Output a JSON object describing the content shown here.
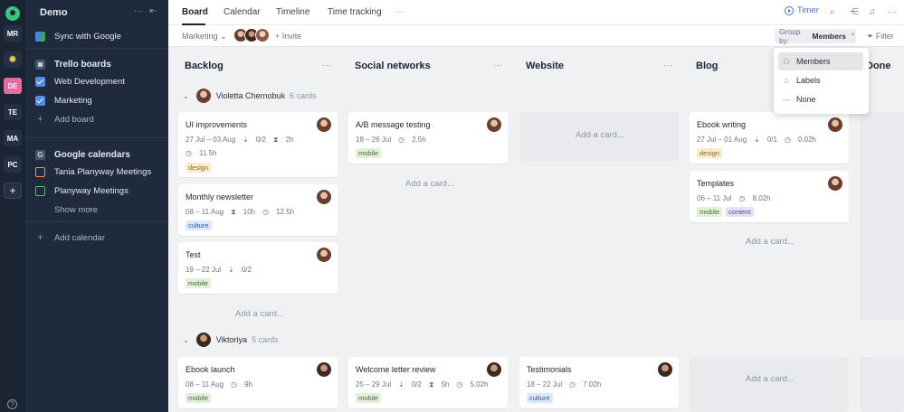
{
  "workspaces": [
    "MR",
    "DE",
    "TE",
    "MA",
    "PC"
  ],
  "sidebar": {
    "title": "Demo",
    "sync_label": "Sync with Google",
    "trello_header": "Trello boards",
    "boards": [
      "Web Development",
      "Marketing"
    ],
    "add_board": "Add board",
    "calendars_header": "Google calendars",
    "calendars": [
      "Tania Planyway Meetings",
      "Planyway Meetings"
    ],
    "show_more": "Show more",
    "add_calendar": "Add calendar"
  },
  "tabs": [
    "Board",
    "Calendar",
    "Timeline",
    "Time tracking"
  ],
  "toolbar": {
    "timer": "Timer",
    "board_filter": "Marketing",
    "invite": "Invite",
    "group_by_label": "Group by:",
    "group_by_value": "Members",
    "filter": "Filter"
  },
  "columns": [
    "Backlog",
    "Social networks",
    "Website",
    "Blog",
    "Done"
  ],
  "groups": [
    {
      "name": "Violetta Chernobuk",
      "count": "6 cards"
    },
    {
      "name": "Viktoriya",
      "count": "5 cards"
    }
  ],
  "cards": {
    "ui": {
      "title": "UI improvements",
      "dates": "27 Jul – 03 Aug",
      "checklist": "0/2",
      "estimate": "2h",
      "time": "11.5h",
      "tag": "design"
    },
    "newsletter": {
      "title": "Monthly newsletter",
      "dates": "08 – 11 Aug",
      "estimate": "10h",
      "time": "12.5h",
      "tag": "culture"
    },
    "test": {
      "title": "Test",
      "dates": "19 – 22 Jul",
      "checklist": "0/2",
      "tag": "mobile"
    },
    "ab": {
      "title": "A/B message testing",
      "dates": "18 – 26 Jul",
      "time": "2.5h",
      "tag": "mobile"
    },
    "ebookw": {
      "title": "Ebook writing",
      "dates": "27 Jul – 01 Aug",
      "checklist": "0/1",
      "time": "0.02h",
      "tag": "design"
    },
    "templates": {
      "title": "Templates",
      "dates": "06 – 11 Jul",
      "time": "8.02h",
      "tag1": "mobile",
      "tag2": "content"
    },
    "ebookl": {
      "title": "Ebook launch",
      "dates": "08 – 11 Aug",
      "time": "9h",
      "tag": "mobile"
    },
    "welcome": {
      "title": "Welcome letter review",
      "dates": "25 – 29 Jul",
      "checklist": "0/2",
      "estimate": "5h",
      "time": "5.02h",
      "tag": "mobile"
    },
    "testimonials": {
      "title": "Testimonials",
      "dates": "18 – 22 Jul",
      "time": "7.02h",
      "tag": "culture"
    }
  },
  "add_card": "Add a card...",
  "dropdown": [
    "Members",
    "Labels",
    "None"
  ]
}
